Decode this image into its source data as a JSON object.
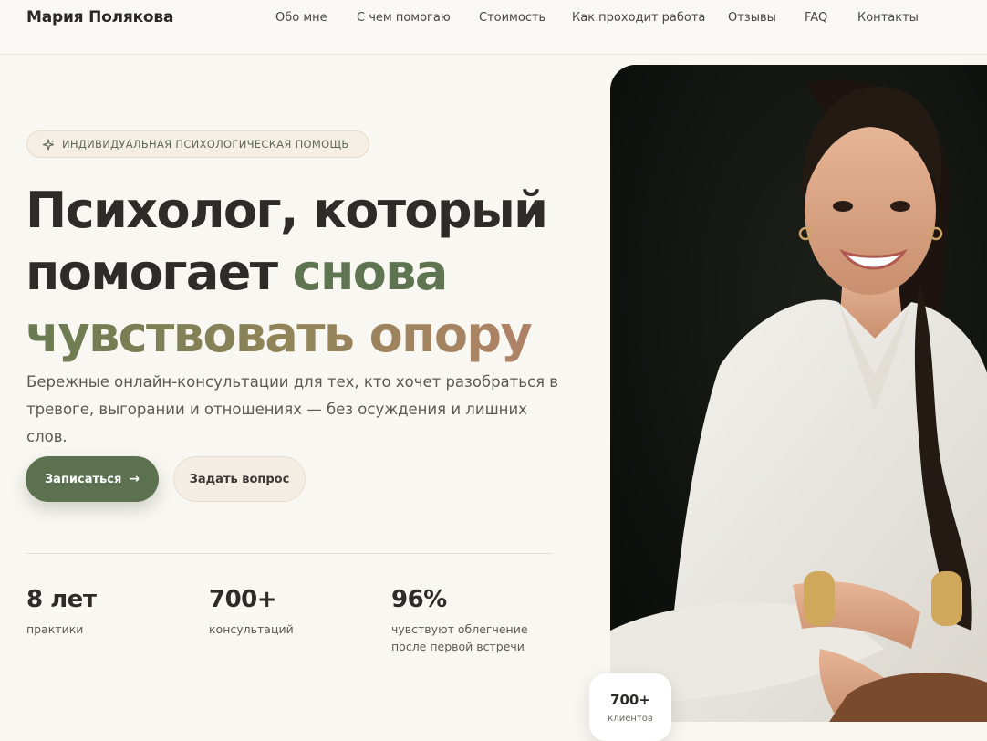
{
  "header": {
    "brand": "Мария Полякова",
    "nav": [
      {
        "label": "Обо мне"
      },
      {
        "label": "С чем помогаю"
      },
      {
        "label": "Стоимость"
      },
      {
        "label": "Как проходит работа"
      },
      {
        "label": "Отзывы"
      },
      {
        "label": "FAQ"
      },
      {
        "label": "Контакты"
      }
    ]
  },
  "hero": {
    "badge": "ИНДИВИДУАЛЬНАЯ ПСИХОЛОГИЧЕСКАЯ ПОМОЩЬ",
    "title_line1": "Психолог, который",
    "title_line2_a": "помогает ",
    "title_line2_b": "снова",
    "title_line3": "чувствовать опору",
    "subtitle": "Бережные онлайн-консультации для тех, кто хочет разобраться в тревоге, выгорании и отношениях — без осуждения и лишних слов.",
    "primary_button": "Записаться",
    "secondary_button": "Задать вопрос"
  },
  "stats": [
    {
      "value": "8 лет",
      "label": "практики"
    },
    {
      "value": "700+",
      "label": "консультаций"
    },
    {
      "value": "96%",
      "label": "чувствуют облегчение после первой встречи"
    }
  ],
  "photo_card": {
    "value": "700+",
    "label": "клиентов"
  },
  "colors": {
    "accent_green": "#5c7150",
    "accent_rose": "#b8826a",
    "background": "#f9f7f2"
  }
}
